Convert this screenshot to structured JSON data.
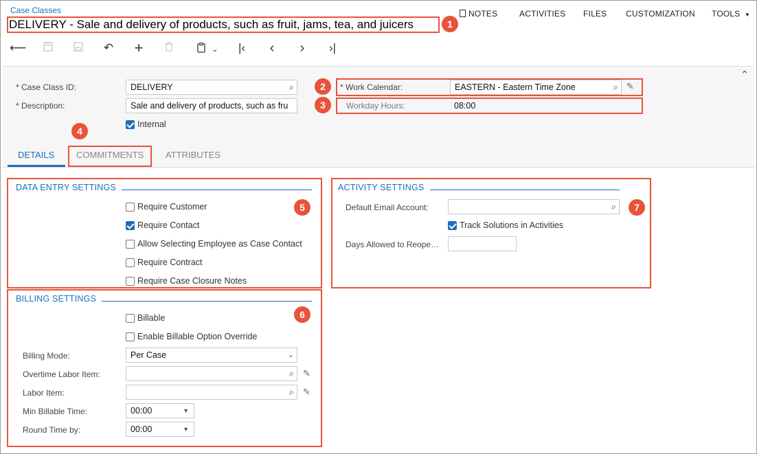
{
  "breadcrumb": "Case Classes",
  "page_title": "DELIVERY - Sale and delivery of products, such as fruit, jams, tea, and juicers",
  "top_nav": {
    "notes": "NOTES",
    "activities": "ACTIVITIES",
    "files": "FILES",
    "customization": "CUSTOMIZATION",
    "tools": "TOOLS"
  },
  "toolbar_icons": [
    "undo-back-icon",
    "save-close-icon",
    "save-icon",
    "cancel-icon",
    "add-icon",
    "delete-icon",
    "copy-paste-icon",
    "first-icon",
    "previous-icon",
    "next-icon",
    "last-icon"
  ],
  "callouts": [
    "1",
    "2",
    "3",
    "4",
    "5",
    "6",
    "7"
  ],
  "header_form": {
    "case_class_id_label": "Case Class ID:",
    "case_class_id_value": "DELIVERY",
    "description_label": "Description:",
    "description_value": "Sale and delivery of products, such as fru",
    "internal_label": "Internal",
    "internal_checked": true,
    "work_calendar_label": "Work Calendar:",
    "work_calendar_value": "EASTERN - Eastern Time Zone",
    "workday_hours_label": "Workday Hours:",
    "workday_hours_value": "08:00",
    "required_marker": "*"
  },
  "tabs": [
    {
      "label": "DETAILS",
      "active": true
    },
    {
      "label": "COMMITMENTS",
      "active": false
    },
    {
      "label": "ATTRIBUTES",
      "active": false
    }
  ],
  "data_entry": {
    "title": "DATA ENTRY SETTINGS",
    "items": [
      {
        "label": "Require Customer",
        "checked": false
      },
      {
        "label": "Require Contact",
        "checked": true
      },
      {
        "label": "Allow Selecting Employee as Case Contact",
        "checked": false
      },
      {
        "label": "Require Contract",
        "checked": false
      },
      {
        "label": "Require Case Closure Notes",
        "checked": false
      }
    ]
  },
  "billing": {
    "title": "BILLING SETTINGS",
    "billable_label": "Billable",
    "billable_checked": false,
    "override_label": "Enable Billable Option Override",
    "override_checked": false,
    "billing_mode_label": "Billing Mode:",
    "billing_mode_value": "Per Case",
    "overtime_label": "Overtime Labor Item:",
    "overtime_value": "",
    "labor_label": "Labor Item:",
    "labor_value": "",
    "min_billable_label": "Min Billable Time:",
    "min_billable_value": "00:00",
    "round_label": "Round Time by:",
    "round_value": "00:00"
  },
  "activity": {
    "title": "ACTIVITY SETTINGS",
    "email_label": "Default Email Account:",
    "email_value": "",
    "track_label": "Track Solutions in Activities",
    "track_checked": true,
    "days_label": "Days Allowed to Reope…",
    "days_value": ""
  },
  "colors": {
    "accent": "#1c6fbc",
    "callout": "#e8533a"
  }
}
